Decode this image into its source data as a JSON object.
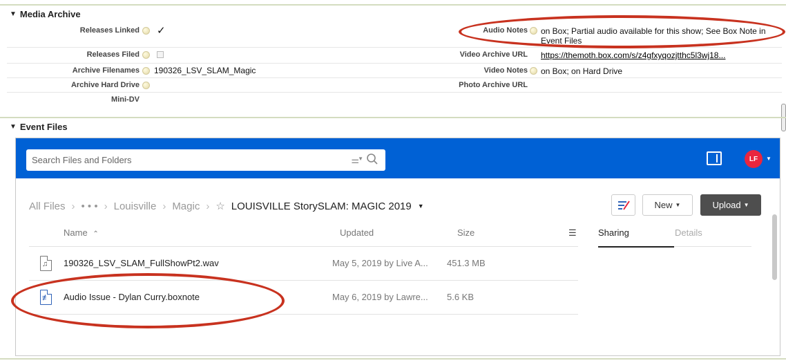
{
  "media_archive": {
    "title": "Media Archive",
    "fields": {
      "releases_linked": {
        "label": "Releases Linked",
        "value": "✓"
      },
      "releases_filed": {
        "label": "Releases Filed",
        "value": ""
      },
      "archive_filenames": {
        "label": "Archive Filenames",
        "value": "190326_LSV_SLAM_Magic"
      },
      "archive_hard_drive": {
        "label": "Archive Hard Drive",
        "value": ""
      },
      "mini_dv": {
        "label": "Mini-DV",
        "value": ""
      },
      "audio_notes": {
        "label": "Audio Notes",
        "value_line1": "on Box; Partial audio available for this show; See Box Note in",
        "value_line2": "Event Files"
      },
      "video_archive_url": {
        "label": "Video Archive URL",
        "value": "https://themoth.box.com/s/z4gfxyqozjtthc5l3wj18..."
      },
      "video_notes": {
        "label": "Video Notes",
        "value": "on Box; on Hard Drive"
      },
      "photo_archive_url": {
        "label": "Photo Archive URL",
        "value": ""
      }
    }
  },
  "event_files": {
    "title": "Event Files",
    "box": {
      "search_placeholder": "Search Files and Folders",
      "avatar_initials": "LF",
      "breadcrumb": {
        "all_files": "All Files",
        "ellipsis": "• • •",
        "louisville": "Louisville",
        "magic": "Magic",
        "current": "LOUISVILLE StorySLAM: MAGIC 2019"
      },
      "buttons": {
        "new": "New",
        "upload": "Upload"
      },
      "columns": {
        "name": "Name",
        "updated": "Updated",
        "size": "Size"
      },
      "tabs": {
        "sharing": "Sharing",
        "details": "Details"
      },
      "files": [
        {
          "name": "190326_LSV_SLAM_FullShowPt2.wav",
          "updated": "May 5, 2019 by Live A...",
          "size": "451.3 MB",
          "icon": "audio-file-icon"
        },
        {
          "name": "Audio Issue - Dylan Curry.boxnote",
          "updated": "May 6, 2019 by Lawre...",
          "size": "5.6 KB",
          "icon": "boxnote-file-icon"
        }
      ]
    }
  },
  "colors": {
    "box_blue": "#0061d5",
    "annotation_red": "#c8321f",
    "avatar_red": "#e9263e"
  }
}
